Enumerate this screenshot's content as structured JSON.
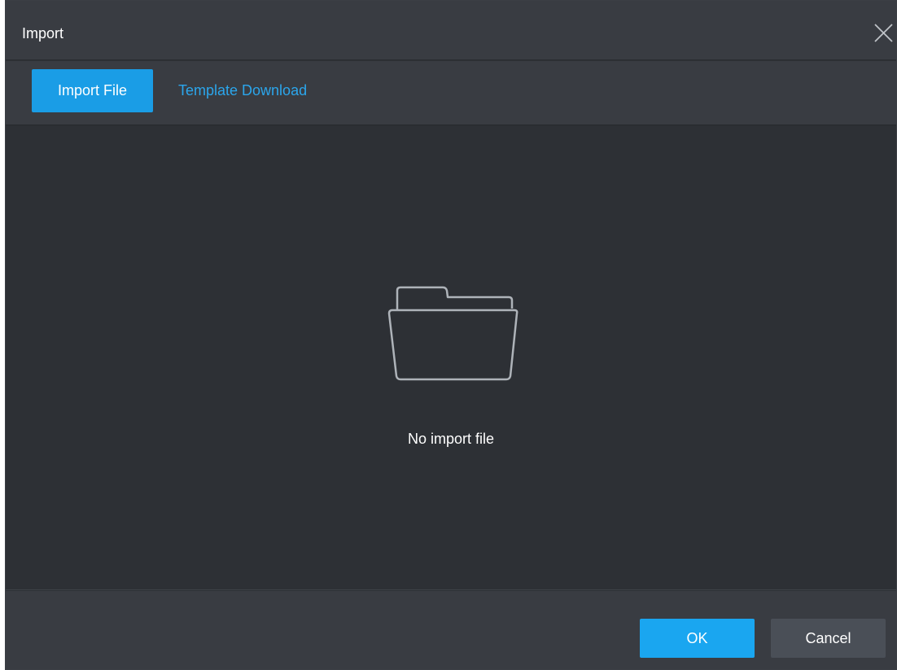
{
  "dialog": {
    "title": "Import",
    "close_icon": "close-icon"
  },
  "tabs": {
    "import_file": "Import File",
    "template_download": "Template Download"
  },
  "empty_state": {
    "icon": "folder-icon",
    "message": "No import file"
  },
  "footer": {
    "ok_label": "OK",
    "cancel_label": "Cancel"
  },
  "colors": {
    "accent": "#1a9de6",
    "link": "#2ba6ec",
    "background": "#2d3035",
    "panel": "#393c42"
  }
}
